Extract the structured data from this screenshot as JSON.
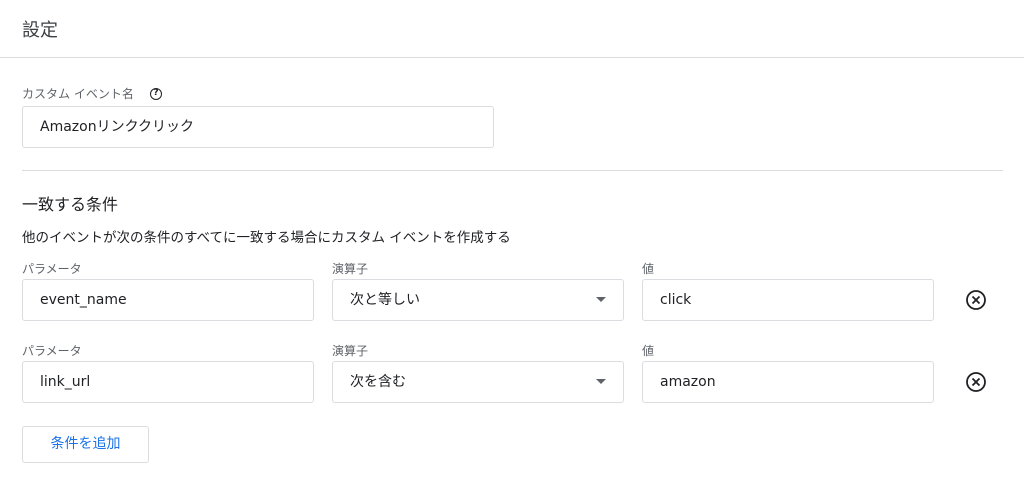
{
  "header": {
    "title": "設定"
  },
  "event_name": {
    "label": "カスタム イベント名",
    "help_icon": "help-circle-icon",
    "value": "Amazonリンククリック"
  },
  "conditions": {
    "title": "一致する条件",
    "description": "他のイベントが次の条件のすべてに一致する場合にカスタム イベントを作成する",
    "rows": [
      {
        "param_label": "パラメータ",
        "param_value": "event_name",
        "operator_label": "演算子",
        "operator_value": "次と等しい",
        "value_label": "値",
        "value_value": "click",
        "remove_icon": "remove-circle-icon"
      },
      {
        "param_label": "パラメータ",
        "param_value": "link_url",
        "operator_label": "演算子",
        "operator_value": "次を含む",
        "value_label": "値",
        "value_value": "amazon",
        "remove_icon": "remove-circle-icon"
      }
    ],
    "add_button_label": "条件を追加"
  },
  "colors": {
    "accent": "#1a73e8",
    "border": "#dadce0",
    "text": "#202124",
    "label": "#5f6368"
  }
}
